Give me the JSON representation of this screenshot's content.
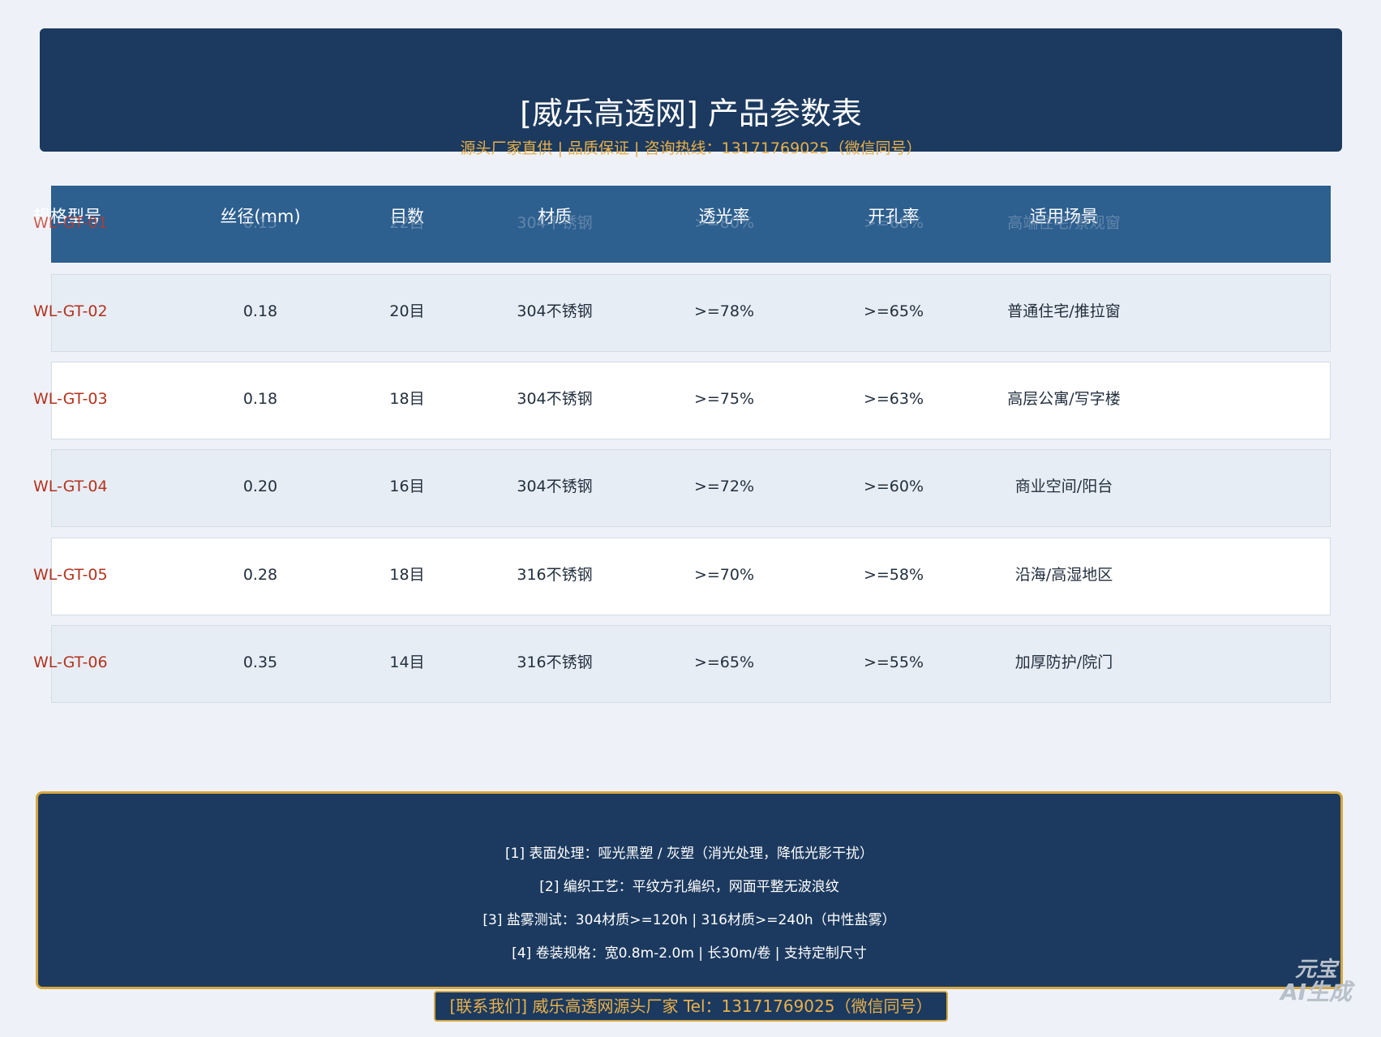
{
  "header": {
    "title": "[威乐高透网] 产品参数表",
    "subtitle": "源头厂家直供 | 品质保证 | 咨询热线：13171769025（微信同号）"
  },
  "table": {
    "columns": [
      "规格型号",
      "丝径(mm)",
      "目数",
      "材质",
      "透光率",
      "开孔率",
      "适用场景"
    ],
    "hidden_row": [
      "WL-GT-01",
      "0.15",
      "22目",
      "304不锈钢",
      ">=80%",
      ">=68%",
      "高端住宅/景观窗"
    ],
    "rows": [
      [
        "WL-GT-02",
        "0.18",
        "20目",
        "304不锈钢",
        ">=78%",
        ">=65%",
        "普通住宅/推拉窗"
      ],
      [
        "WL-GT-03",
        "0.18",
        "18目",
        "304不锈钢",
        ">=75%",
        ">=63%",
        "高层公寓/写字楼"
      ],
      [
        "WL-GT-04",
        "0.20",
        "16目",
        "304不锈钢",
        ">=72%",
        ">=60%",
        "商业空间/阳台"
      ],
      [
        "WL-GT-05",
        "0.28",
        "18目",
        "316不锈钢",
        ">=70%",
        ">=58%",
        "沿海/高湿地区"
      ],
      [
        "WL-GT-06",
        "0.35",
        "14目",
        "316不锈钢",
        ">=65%",
        ">=55%",
        "加厚防护/院门"
      ]
    ]
  },
  "notes": [
    "[1] 表面处理：哑光黑塑 / 灰塑（消光处理，降低光影干扰）",
    "[2] 编织工艺：平纹方孔编织，网面平整无波浪纹",
    "[3] 盐雾测试：304材质>=120h  |  316材质>=240h（中性盐雾）",
    "[4] 卷装规格：宽0.8m-2.0m  |  长30m/卷  |  支持定制尺寸"
  ],
  "contact": "[联系我们] 威乐高透网源头厂家  Tel：13171769025（微信同号）",
  "watermark": {
    "line1": "元宝",
    "line2": "AI生成"
  },
  "colors": {
    "navy": "#1c3a5f",
    "header_blue": "#2d5f8f",
    "gold": "#e8b04a",
    "model_red": "#b3321f",
    "page_bg": "#eef2f8"
  }
}
